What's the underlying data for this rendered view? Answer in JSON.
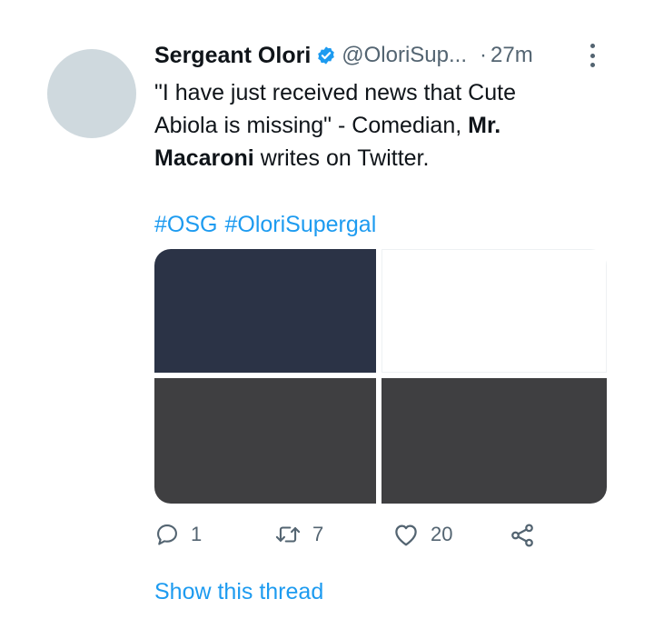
{
  "tweet": {
    "display_name": "Sergeant Olori",
    "handle": "@OloriSup...",
    "separator": "·",
    "time": "27m",
    "text_part1": "\"I have just received news that Cute Abiola is missing\" - Comedian, ",
    "text_bold1": "Mr. Macaroni",
    "text_part2": " writes on Twitter.",
    "hashtags": [
      "#OSG",
      "#OloriSupergal"
    ]
  },
  "actions": {
    "reply_count": "1",
    "retweet_count": "7",
    "like_count": "20"
  },
  "thread_link": "Show this thread",
  "colors": {
    "link": "#1d9bf0",
    "verified": "#1d9bf0",
    "muted": "#536471",
    "avatar": "#cfd9de",
    "tile_dark_blue": "#2b3346",
    "tile_dark_gray": "#3f3f41"
  },
  "icons": [
    "verified-badge-icon",
    "more-options-icon",
    "reply-icon",
    "retweet-icon",
    "like-icon",
    "share-icon"
  ]
}
